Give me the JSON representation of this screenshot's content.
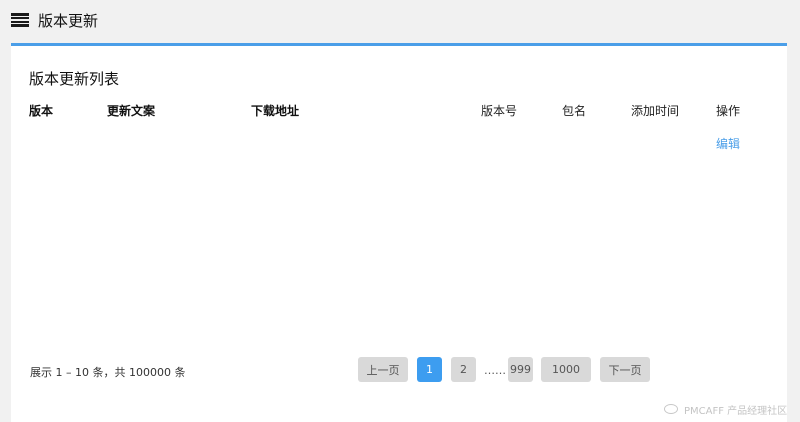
{
  "header": {
    "title": "版本更新",
    "icon": "list-icon"
  },
  "panel": {
    "title": "版本更新列表",
    "columns": {
      "version": "版本",
      "notes": "更新文案",
      "url": "下载地址",
      "version_code": "版本号",
      "package": "包名",
      "added_time": "添加时间",
      "actions": "操作"
    },
    "row_action": "编辑"
  },
  "pagination": {
    "summary": "展示 1 – 10 条，共 100000 条",
    "prev": "上一页",
    "pages": [
      "1",
      "2",
      "999",
      "1000"
    ],
    "current": "1",
    "ellipsis": "……",
    "next": "下一页"
  },
  "watermark": "PMCAFF 产品经理社区",
  "colors": {
    "accent": "#4a9ee8",
    "active_page": "#3d9df0",
    "page_button": "#d9d9d9",
    "background": "#f1f1f1"
  }
}
